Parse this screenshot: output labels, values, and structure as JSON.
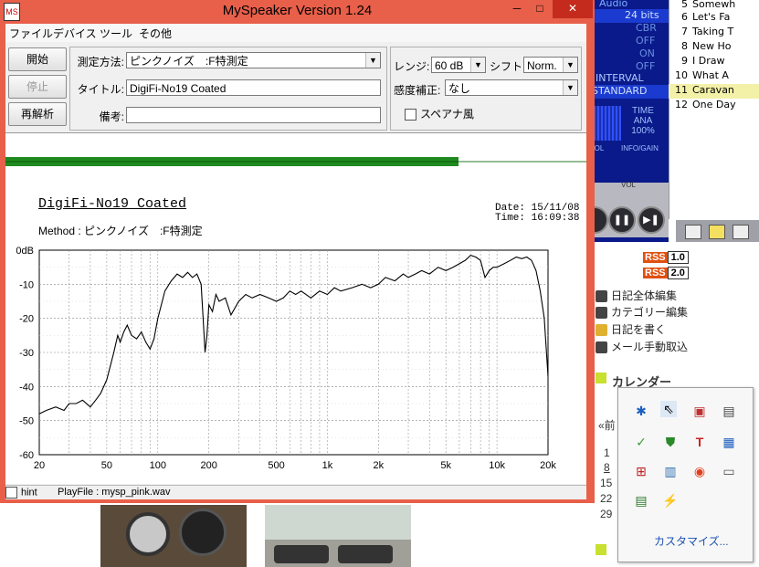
{
  "window": {
    "title": "MySpeaker Version 1.24",
    "app_icon": "speaker-app-icon",
    "controls": {
      "minimize": "─",
      "maximize": "□",
      "close": "✕"
    }
  },
  "menubar": [
    "ファイル",
    "デバイス",
    "ツール",
    "その他"
  ],
  "buttons": {
    "start": "開始",
    "stop": "停止",
    "reanalyze": "再解析"
  },
  "form": {
    "method_label": "測定方法:",
    "method_value": "ピンクノイズ　:F特測定",
    "title_label": "タイトル:",
    "title_value": "DigiFi-No19 Coated",
    "note_label": "備考:",
    "note_value": "",
    "range_label": "レンジ:",
    "range_value": "60 dB",
    "shift_label": "シフト:",
    "shift_value": "Norm.",
    "sensitivity_label": "感度補正:",
    "sensitivity_value": "なし",
    "spectrum_label": "スペアナ風",
    "spectrum_checked": false
  },
  "graph": {
    "title": "DigiFi-No19 Coated",
    "method_line": "Method :  ピンクノイズ　:F特測定",
    "date_line": "Date: 15/11/08",
    "time_line": "Time: 16:09:38"
  },
  "chart_data": {
    "type": "line",
    "xscale": "log",
    "xlim": [
      20,
      20000
    ],
    "ylim": [
      -60,
      0
    ],
    "x_ticks": [
      20,
      50,
      100,
      200,
      500,
      1000,
      2000,
      5000,
      10000,
      20000
    ],
    "x_tick_labels": [
      "20",
      "50",
      "100",
      "200",
      "500",
      "1k",
      "2k",
      "5k",
      "10k",
      "20k"
    ],
    "y_ticks": [
      0,
      -10,
      -20,
      -30,
      -40,
      -50,
      -60
    ],
    "y_tick_labels": [
      "0dB",
      "-10",
      "-20",
      "-30",
      "-40",
      "-50",
      "-60"
    ],
    "grid": true,
    "series": [
      {
        "color": "#000000",
        "x": [
          20,
          22,
          25,
          28,
          30,
          33,
          36,
          40,
          43,
          46,
          50,
          55,
          58,
          60,
          63,
          66,
          70,
          75,
          80,
          85,
          90,
          95,
          100,
          110,
          120,
          130,
          140,
          150,
          160,
          170,
          180,
          185,
          190,
          195,
          200,
          210,
          220,
          230,
          250,
          270,
          300,
          330,
          360,
          400,
          450,
          500,
          550,
          600,
          650,
          700,
          800,
          900,
          1000,
          1100,
          1200,
          1400,
          1600,
          1800,
          2000,
          2200,
          2500,
          2800,
          3000,
          3300,
          3600,
          4000,
          4500,
          5000,
          5500,
          6000,
          6500,
          7000,
          7500,
          8000,
          8500,
          9000,
          9500,
          10000,
          11000,
          12000,
          13000,
          14000,
          15000,
          16000,
          17000,
          18000,
          19000,
          20000
        ],
        "values": [
          -48,
          -47,
          -46,
          -47,
          -45,
          -45,
          -44,
          -46,
          -44,
          -42,
          -38,
          -30,
          -25,
          -27,
          -24,
          -22,
          -25,
          -26,
          -24,
          -27,
          -29,
          -26,
          -20,
          -12,
          -9,
          -7,
          -8,
          -6.5,
          -8,
          -7,
          -10,
          -20,
          -30,
          -25,
          -16,
          -18,
          -13,
          -15,
          -14,
          -19,
          -15,
          -13,
          -14,
          -13,
          -14,
          -15,
          -14,
          -12,
          -13,
          -12,
          -14,
          -12,
          -13,
          -11,
          -12,
          -11,
          -10,
          -11,
          -10,
          -8,
          -9,
          -7,
          -8,
          -7,
          -6,
          -7,
          -5,
          -6,
          -5,
          -4,
          -3,
          -1.5,
          -2,
          -3,
          -8,
          -6,
          -5,
          -5,
          -4,
          -3,
          -2,
          -2.5,
          -2,
          -3,
          -6,
          -12,
          -20,
          -37
        ]
      }
    ]
  },
  "statusbar": {
    "hint_label": "hint",
    "playfile": "PlayFile  :  mysp_pink.wav"
  },
  "media_player": {
    "rows": [
      "Audio",
      "24 bits",
      "CBR",
      "OFF",
      "ON",
      "OFF",
      "INTERVAL",
      "STANDARD"
    ],
    "time_box": [
      "TIME",
      "ANA",
      "100%"
    ],
    "labels": [
      "TROL",
      "INFO/GAIN",
      "VOL"
    ]
  },
  "playlist": [
    {
      "n": "5",
      "t": "Somewh"
    },
    {
      "n": "6",
      "t": "Let's Fa"
    },
    {
      "n": "7",
      "t": "Taking T"
    },
    {
      "n": "8",
      "t": "New Ho"
    },
    {
      "n": "9",
      "t": "I Draw"
    },
    {
      "n": "10",
      "t": "What A"
    },
    {
      "n": "11",
      "t": "Caravan"
    },
    {
      "n": "12",
      "t": "One Day"
    }
  ],
  "blog": {
    "rss1": "1.0",
    "rss2": "2.0",
    "links": [
      "日記全体編集",
      "カテゴリー編集",
      "日記を書く",
      "メール手動取込"
    ],
    "calendar": "カレンダー",
    "cal_nums": [
      "«前",
      "1",
      "8",
      "15",
      "22",
      "29"
    ]
  },
  "tray": {
    "customize": "カスタマイズ..."
  }
}
